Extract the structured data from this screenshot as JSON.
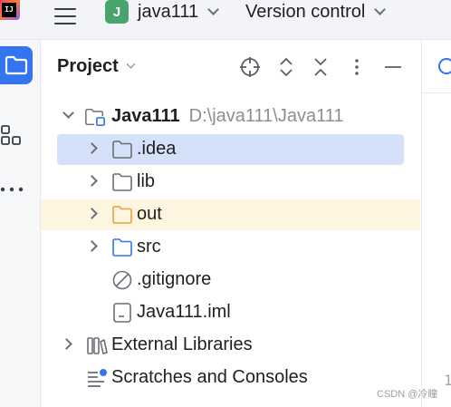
{
  "topbar": {
    "app_logo_text": "IJ",
    "project_badge": "J",
    "project_name": "java111",
    "vcs_label": "Version control"
  },
  "panel": {
    "title": "Project"
  },
  "tree": [
    {
      "label": "Java111",
      "path": "D:\\java111\\Java111"
    },
    {
      "label": ".idea"
    },
    {
      "label": "lib"
    },
    {
      "label": "out"
    },
    {
      "label": "src"
    },
    {
      "label": ".gitignore"
    },
    {
      "label": "Java111.iml"
    },
    {
      "label": "External Libraries"
    },
    {
      "label": "Scratches and Consoles"
    }
  ],
  "editor": {
    "line_number": "1"
  },
  "watermark": "CSDN @冷瞳",
  "colors": {
    "accent": "#3574f0",
    "selection": "#d5e1f9",
    "excluded_highlight": "#fdf5e0",
    "excluded_folder": "#e8a33a",
    "source_folder": "#3574f0",
    "project_badge": "#48a36c"
  }
}
